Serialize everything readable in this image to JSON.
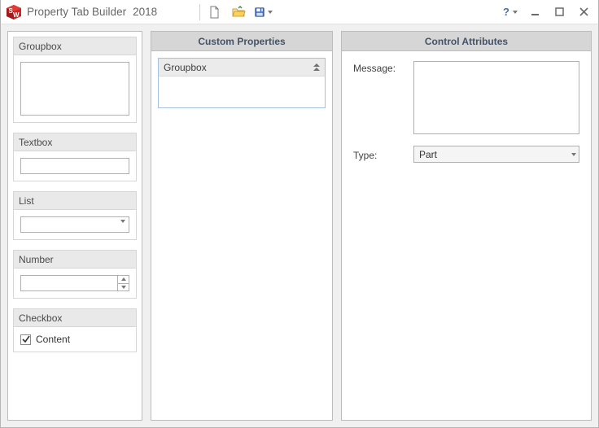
{
  "app": {
    "name": "Property Tab Builder",
    "year": "2018"
  },
  "toolbar": {
    "new_title": "New",
    "open_title": "Open",
    "save_title": "Save"
  },
  "palette": {
    "groupbox": "Groupbox",
    "textbox": "Textbox",
    "list": "List",
    "number": "Number",
    "checkbox": "Checkbox",
    "checkbox_content": "Content"
  },
  "panels": {
    "custom_props": "Custom Properties",
    "control_attrs": "Control Attributes"
  },
  "canvas": {
    "groupbox_caption": "Groupbox"
  },
  "attrs": {
    "message_label": "Message:",
    "type_label": "Type:",
    "type_value": "Part"
  }
}
